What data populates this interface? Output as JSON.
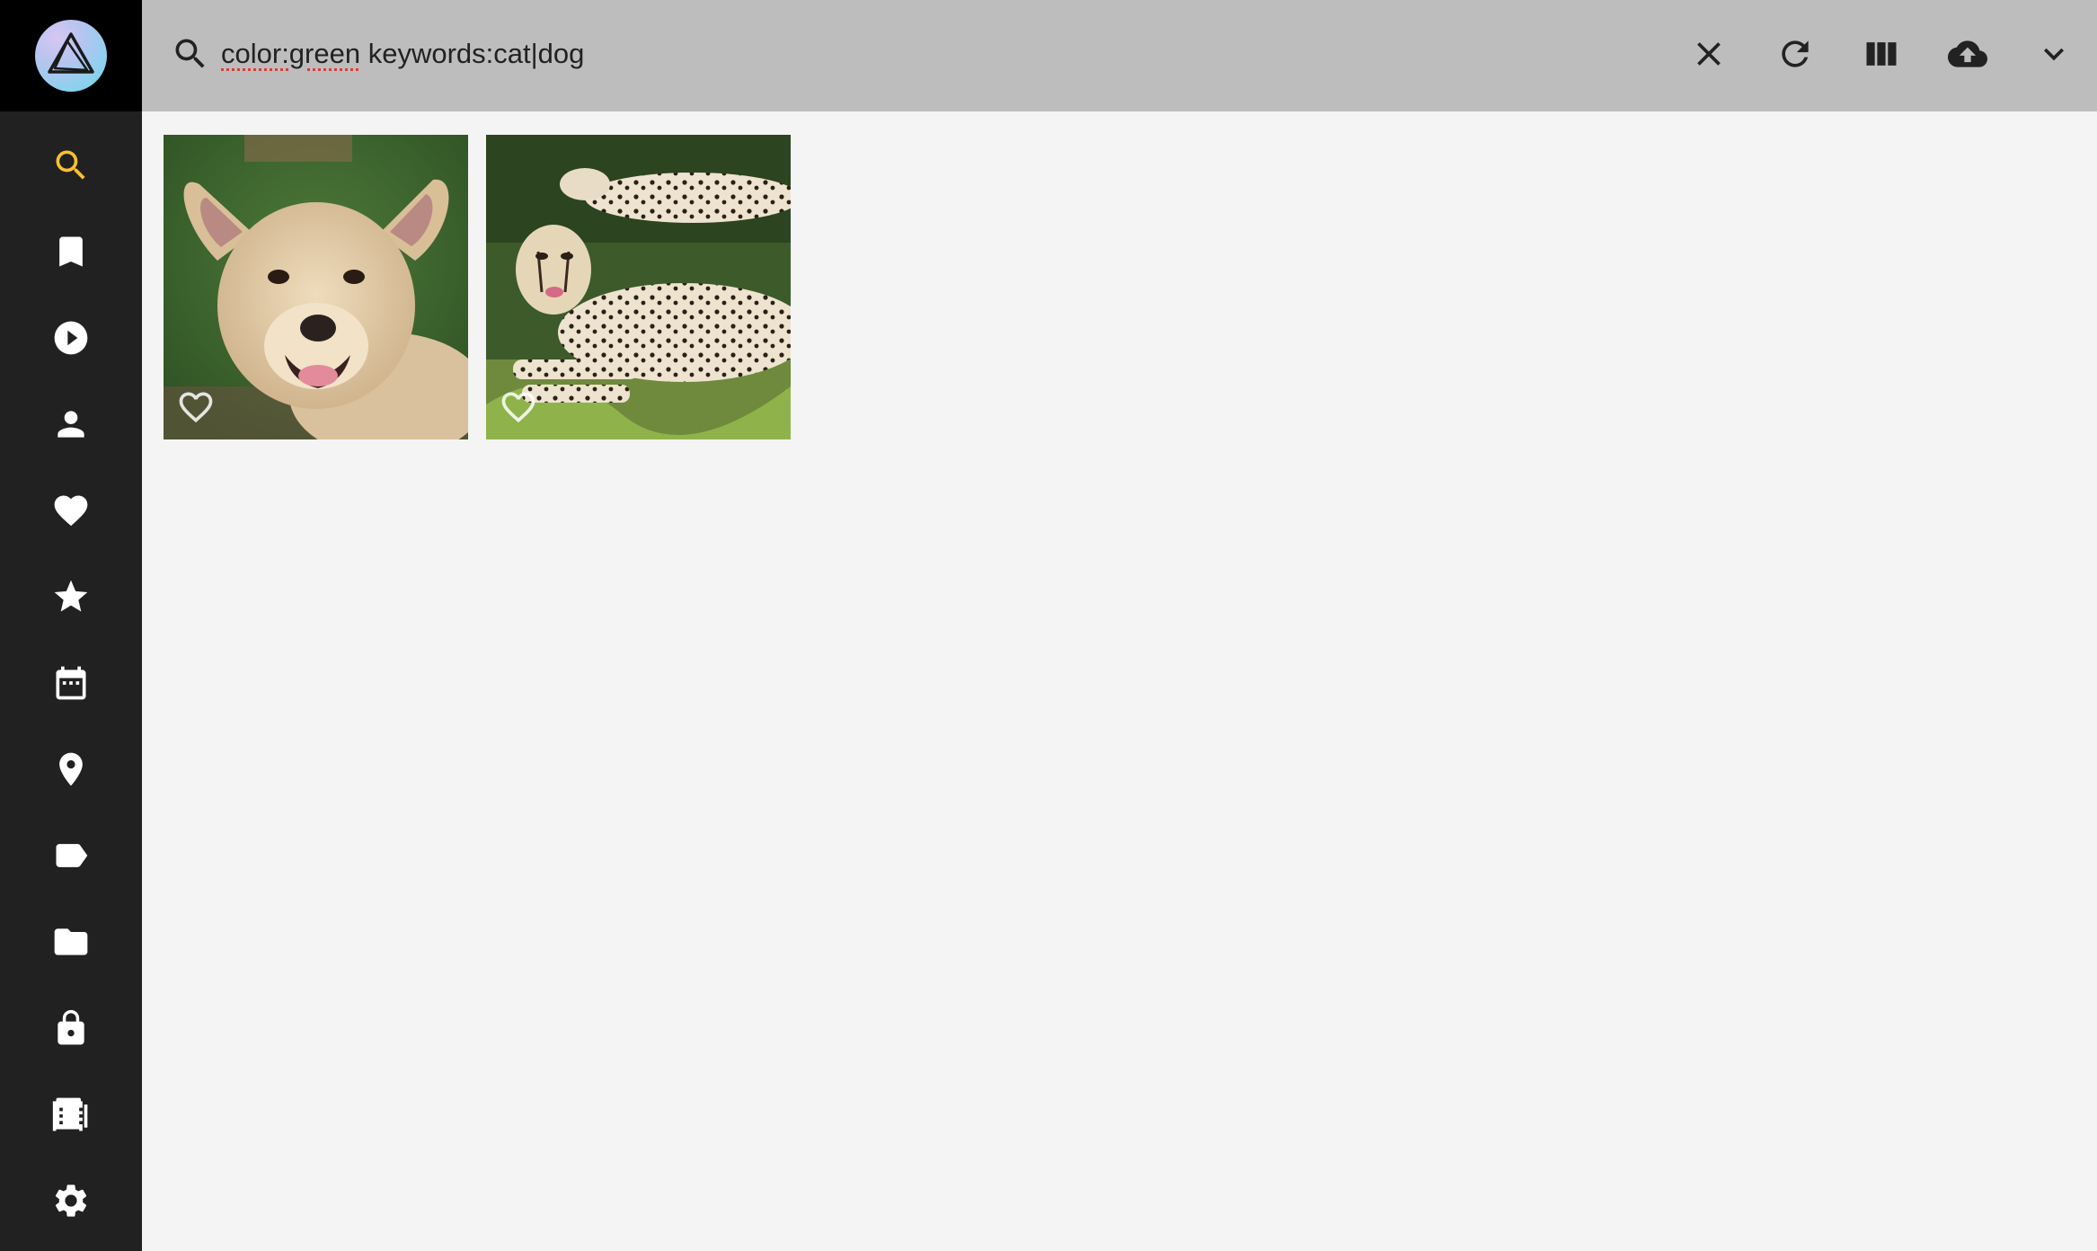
{
  "sidebar": {
    "logo_icon": "app-logo-triangle",
    "accent_color": "#fbc02d",
    "items": [
      {
        "name": "search",
        "icon": "search-icon",
        "active": true
      },
      {
        "name": "bookmarks",
        "icon": "bookmark-icon"
      },
      {
        "name": "videos",
        "icon": "play-icon"
      },
      {
        "name": "people",
        "icon": "person-icon"
      },
      {
        "name": "favorites",
        "icon": "heart-icon"
      },
      {
        "name": "review",
        "icon": "star-icon"
      },
      {
        "name": "calendar",
        "icon": "calendar-icon"
      },
      {
        "name": "places",
        "icon": "location-pin-icon"
      },
      {
        "name": "labels",
        "icon": "label-icon"
      },
      {
        "name": "folders",
        "icon": "folder-icon"
      },
      {
        "name": "private",
        "icon": "lock-icon"
      },
      {
        "name": "library",
        "icon": "film-library-icon"
      },
      {
        "name": "settings",
        "icon": "gear-icon"
      }
    ]
  },
  "search": {
    "query_part1": "color:green",
    "query_part2": " keywords:cat|dog"
  },
  "toolbar": {
    "clear_icon": "close-icon",
    "reload_icon": "refresh-icon",
    "view_icon": "view-columns-icon",
    "upload_icon": "cloud-upload-icon",
    "expand_icon": "chevron-down-icon"
  },
  "results": [
    {
      "subject": "dog",
      "favorite": false
    },
    {
      "subject": "cheetah",
      "favorite": false
    }
  ]
}
